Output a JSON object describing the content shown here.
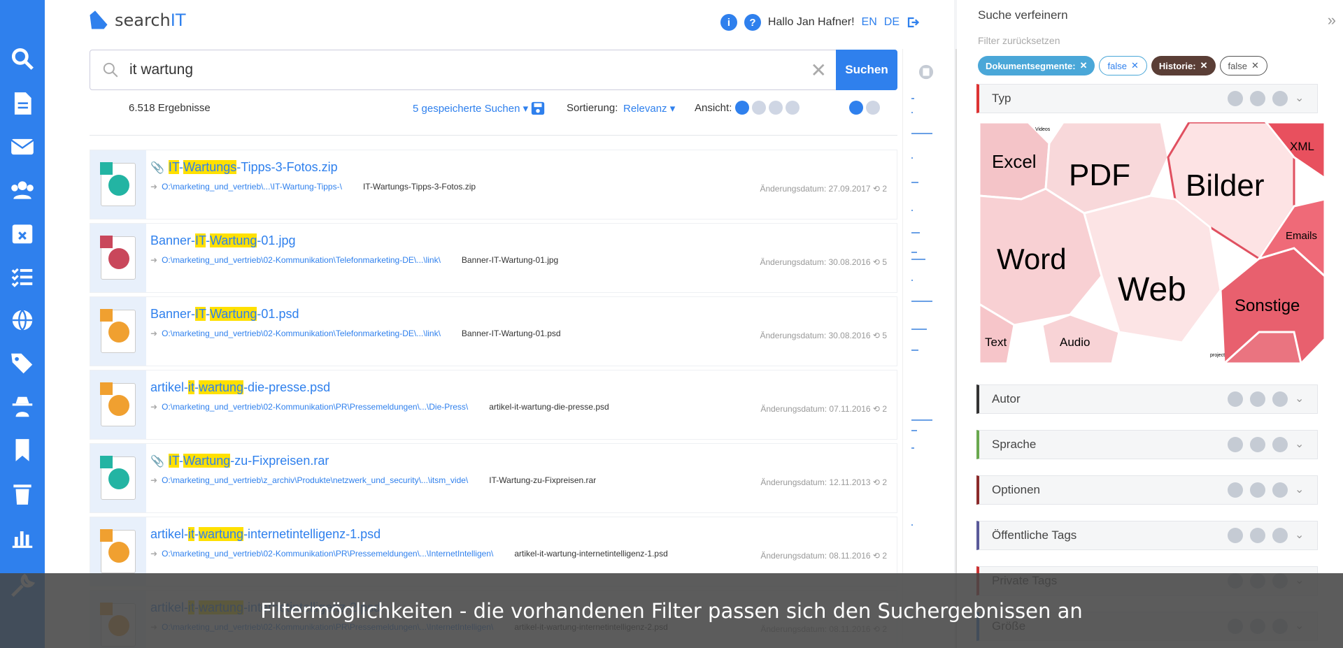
{
  "header": {
    "logo_part1": "search",
    "logo_part2": "IT",
    "greeting": "Hallo Jan Hafner!",
    "lang_en": "EN",
    "lang_de": "DE"
  },
  "search": {
    "query": "it wartung",
    "button": "Suchen"
  },
  "toolbar": {
    "results_count": "6.518 Ergebnisse",
    "saved": "5 gespeicherte Suchen",
    "sort_label": "Sortierung:",
    "sort_value": "Relevanz",
    "view_label": "Ansicht:"
  },
  "results": [
    {
      "title_pre": "",
      "hl1": "IT",
      "mid1": "-",
      "hl2": "Wartungs",
      "title_post": "-Tipps-3-Fotos.zip",
      "path": "O:\\marketing_und_vertrieb\\...\\IT-Wartung-Tipps-\\",
      "fname": "IT-Wartungs-Tipps-3-Fotos.zip",
      "date": "Änderungsdatum: 27.09.2017",
      "ver": "2",
      "icon": "zip"
    },
    {
      "title_pre": "Banner-",
      "hl1": "IT",
      "mid1": "-",
      "hl2": "Wartung",
      "title_post": "-01.jpg",
      "path": "O:\\marketing_und_vertrieb\\02-Kommunikation\\Telefonmarketing-DE\\...\\link\\",
      "fname": "Banner-IT-Wartung-01.jpg",
      "date": "Änderungsdatum: 30.08.2016",
      "ver": "5",
      "icon": "jpg"
    },
    {
      "title_pre": "Banner-",
      "hl1": "IT",
      "mid1": "-",
      "hl2": "Wartung",
      "title_post": "-01.psd",
      "path": "O:\\marketing_und_vertrieb\\02-Kommunikation\\Telefonmarketing-DE\\...\\link\\",
      "fname": "Banner-IT-Wartung-01.psd",
      "date": "Änderungsdatum: 30.08.2016",
      "ver": "5",
      "icon": "psd"
    },
    {
      "title_pre": "artikel-",
      "hl1": "it",
      "mid1": "-",
      "hl2": "wartung",
      "title_post": "-die-presse.psd",
      "path": "O:\\marketing_und_vertrieb\\02-Kommunikation\\PR\\Pressemeldungen\\...\\Die-Press\\",
      "fname": "artikel-it-wartung-die-presse.psd",
      "date": "Änderungsdatum: 07.11.2016",
      "ver": "2",
      "icon": "psd"
    },
    {
      "title_pre": "",
      "hl1": "IT",
      "mid1": "-",
      "hl2": "Wartung",
      "title_post": "-zu-Fixpreisen.rar",
      "path": "O:\\marketing_und_vertrieb\\z_archiv\\Produkte\\netzwerk_und_security\\...\\itsm_vide\\",
      "fname": "IT-Wartung-zu-Fixpreisen.rar",
      "date": "Änderungsdatum: 12.11.2013",
      "ver": "2",
      "icon": "zip"
    },
    {
      "title_pre": "artikel-",
      "hl1": "it",
      "mid1": "-",
      "hl2": "wartung",
      "title_post": "-internetintelligenz-1.psd",
      "path": "O:\\marketing_und_vertrieb\\02-Kommunikation\\PR\\Pressemeldungen\\...\\InternetIntelligen\\",
      "fname": "artikel-it-wartung-internetintelligenz-1.psd",
      "date": "Änderungsdatum: 08.11.2016",
      "ver": "2",
      "icon": "psd"
    },
    {
      "title_pre": "artikel-",
      "hl1": "it",
      "mid1": "-",
      "hl2": "wartung",
      "title_post": "-internetintelligenz-2.psd",
      "path": "O:\\marketing_und_vertrieb\\02-Kommunikation\\PR\\Pressemeldungen\\...\\InternetIntelligen\\",
      "fname": "artikel-it-wartung-internetintelligenz-2.psd",
      "date": "Änderungsdatum: 08.11.2016",
      "ver": "2",
      "icon": "psd"
    }
  ],
  "panel": {
    "title": "Suche verfeinern",
    "reset": "Filter zurücksetzen",
    "chips": [
      "Dokumentsegmente:",
      "false",
      "Historie:",
      "false"
    ],
    "sections": [
      "Typ",
      "Autor",
      "Sprache",
      "Optionen",
      "Öffentliche Tags",
      "Private Tags",
      "Größe"
    ],
    "section_colors": [
      "#d33",
      "#333",
      "#6aa84f",
      "#8b2b2b",
      "#5a5a9a",
      "#c33",
      "#2f80ed"
    ],
    "types": [
      "Excel",
      "PDF",
      "Bilder",
      "XML",
      "Word",
      "Web",
      "Sonstige",
      "Emails",
      "Text",
      "Audio",
      "Videos",
      "project"
    ]
  },
  "caption": "Filtermöglichkeiten - die vorhandenen Filter passen sich den Suchergebnissen an"
}
